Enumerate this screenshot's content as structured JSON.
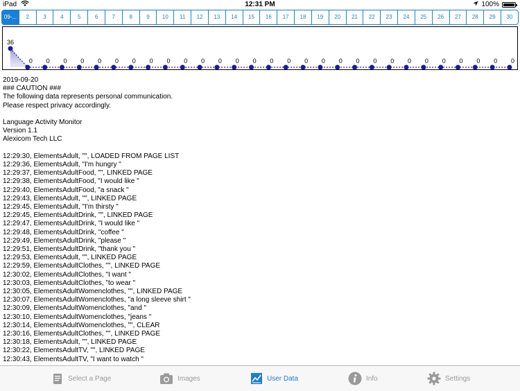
{
  "status": {
    "device": "iPad",
    "time": "12:31 PM",
    "battery": "100%"
  },
  "days": [
    "09-...",
    "2",
    "3",
    "4",
    "5",
    "6",
    "7",
    "8",
    "9",
    "10",
    "11",
    "12",
    "13",
    "14",
    "15",
    "16",
    "17",
    "18",
    "19",
    "20",
    "21",
    "22",
    "23",
    "24",
    "25",
    "26",
    "27",
    "28",
    "29",
    "30"
  ],
  "chart_data": {
    "type": "area",
    "x": [
      1,
      2,
      3,
      4,
      5,
      6,
      7,
      8,
      9,
      10,
      11,
      12,
      13,
      14,
      15,
      16,
      17,
      18,
      19,
      20,
      21,
      22,
      23,
      24,
      25,
      26,
      27,
      28,
      29,
      30
    ],
    "values": [
      36,
      0,
      0,
      0,
      0,
      0,
      0,
      0,
      0,
      0,
      0,
      0,
      0,
      0,
      0,
      0,
      0,
      0,
      0,
      0,
      0,
      0,
      0,
      0,
      0,
      0,
      0,
      0,
      0,
      0
    ],
    "data_labels": [
      "36",
      "0",
      "0",
      "0",
      "0",
      "0",
      "0",
      "0",
      "0",
      "0",
      "0",
      "0",
      "0",
      "0",
      "0",
      "0",
      "0",
      "0",
      "0",
      "0",
      "0",
      "0",
      "0",
      "0",
      "0",
      "0",
      "0",
      "0",
      "0",
      "0"
    ],
    "ylim": [
      0,
      36
    ],
    "color": "#1a1aa0"
  },
  "log_lines": [
    "2019-09-20",
    "### CAUTION ###",
    "The following data represents personal communication.",
    "Please respect privacy accordingly.",
    "",
    "Language Activity Monitor",
    "Version 1.1",
    "Alexicom Tech LLC",
    "",
    "12:29:30, ElementsAdult, \"\", LOADED FROM PAGE LIST",
    "12:29:36, ElementsAdult, \"I'm hungry \"",
    "12:29:37, ElementsAdultFood, \"\", LINKED PAGE",
    "12:29:38, ElementsAdultFood, \"I would like \"",
    "12:29:40, ElementsAdultFood, \"a snack \"",
    "12:29:43, ElementsAdult, \"\", LINKED PAGE",
    "12:29:45, ElementsAdult, \"I'm thirsty \"",
    "12:29:45, ElementsAdultDrink, \"\", LINKED PAGE",
    "12:29:47, ElementsAdultDrink, \"I would like \"",
    "12:29:48, ElementsAdultDrink, \"coffee \"",
    "12:29:49, ElementsAdultDrink, \"please \"",
    "12:29:51, ElementsAdultDrink, \"thank you \"",
    "12:29:53, ElementsAdult, \"\", LINKED PAGE",
    "12:29:59, ElementsAdultClothes, \"\", LINKED PAGE",
    "12:30:02, ElementsAdultClothes, \"I want \"",
    "12:30:03, ElementsAdultClothes, \"to wear \"",
    "12:30:05, ElementsAdultWomenclothes, \"\", LINKED PAGE",
    "12:30:07, ElementsAdultWomenclothes, \"a long sleeve shirt \"",
    "12:30:09, ElementsAdultWomenclothes, \"and \"",
    "12:30:10, ElementsAdultWomenclothes, \"jeans \"",
    "12:30:14, ElementsAdultWomenclothes, \"\", CLEAR",
    "12:30:16, ElementsAdultClothes, \"\", LINKED PAGE",
    "12:30:18, ElementsAdult, \"\", LINKED PAGE",
    "12:30:22, ElementsAdultTV, \"\", LINKED PAGE",
    "12:30:43, ElementsAdultTV, \"I want to watch \""
  ],
  "tabs": {
    "select_page": "Select a Page",
    "images": "Images",
    "user_data": "User Data",
    "info": "Info",
    "settings": "Settings"
  }
}
